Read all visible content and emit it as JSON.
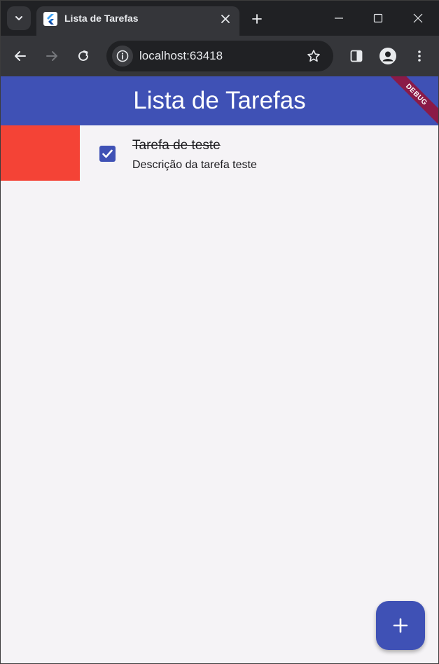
{
  "browser": {
    "tab": {
      "title": "Lista de Tarefas"
    },
    "omnibox": {
      "url": "localhost:63418"
    }
  },
  "app": {
    "appbar_title": "Lista de Tarefas",
    "debug_banner": "DEBUG",
    "tasks": [
      {
        "title": "Tarefa de teste",
        "description": "Descrição da tarefa teste",
        "done": true
      }
    ],
    "colors": {
      "primary": "#3f51b5",
      "delete_background": "#f44336",
      "debug_banner": "#8b1a47",
      "background": "#f5f3f6"
    }
  }
}
